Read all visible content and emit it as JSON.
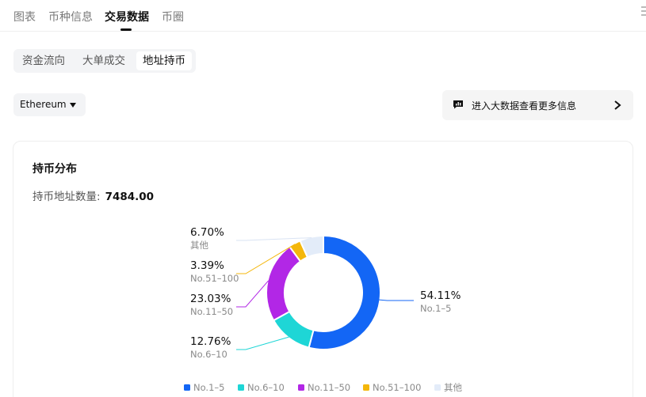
{
  "top_tabs": [
    {
      "label": "图表",
      "active": false
    },
    {
      "label": "币种信息",
      "active": false
    },
    {
      "label": "交易数据",
      "active": true
    },
    {
      "label": "币圈",
      "active": false
    }
  ],
  "sub_tabs": [
    {
      "label": "资金流向",
      "active": false
    },
    {
      "label": "大单成交",
      "active": false
    },
    {
      "label": "地址持币",
      "active": true
    }
  ],
  "chain_select": {
    "value": "Ethereum",
    "icon": "chevron-down-icon"
  },
  "bigdata_button": {
    "label": "进入大数据查看更多信息",
    "icon": "chat-chart-icon",
    "arrow_icon": "chevron-right-icon"
  },
  "card": {
    "title": "持币分布",
    "count_label": "持币地址数量:",
    "count_value": "7484.00"
  },
  "colors": {
    "no1_5": "#1366f5",
    "no6_10": "#1ed6d6",
    "no11_50": "#b227e6",
    "no51_100": "#f4b70b",
    "other": "#e3ecf9"
  },
  "chart_data": {
    "type": "pie",
    "style": "donut",
    "title": "",
    "slices": [
      {
        "name": "No.1–5",
        "value": 54.11,
        "label": "54.11%",
        "color": "#1366f5"
      },
      {
        "name": "No.6–10",
        "value": 12.76,
        "label": "12.76%",
        "color": "#1ed6d6"
      },
      {
        "name": "No.11–50",
        "value": 23.03,
        "label": "23.03%",
        "color": "#b227e6"
      },
      {
        "name": "No.51–100",
        "value": 3.39,
        "label": "3.39%",
        "color": "#f4b70b"
      },
      {
        "name": "其他",
        "value": 6.7,
        "label": "6.70%",
        "color": "#e3ecf9"
      }
    ],
    "legend": [
      "No.1–5",
      "No.6–10",
      "No.11–50",
      "No.51–100",
      "其他"
    ],
    "legend_placement": "bottom"
  }
}
